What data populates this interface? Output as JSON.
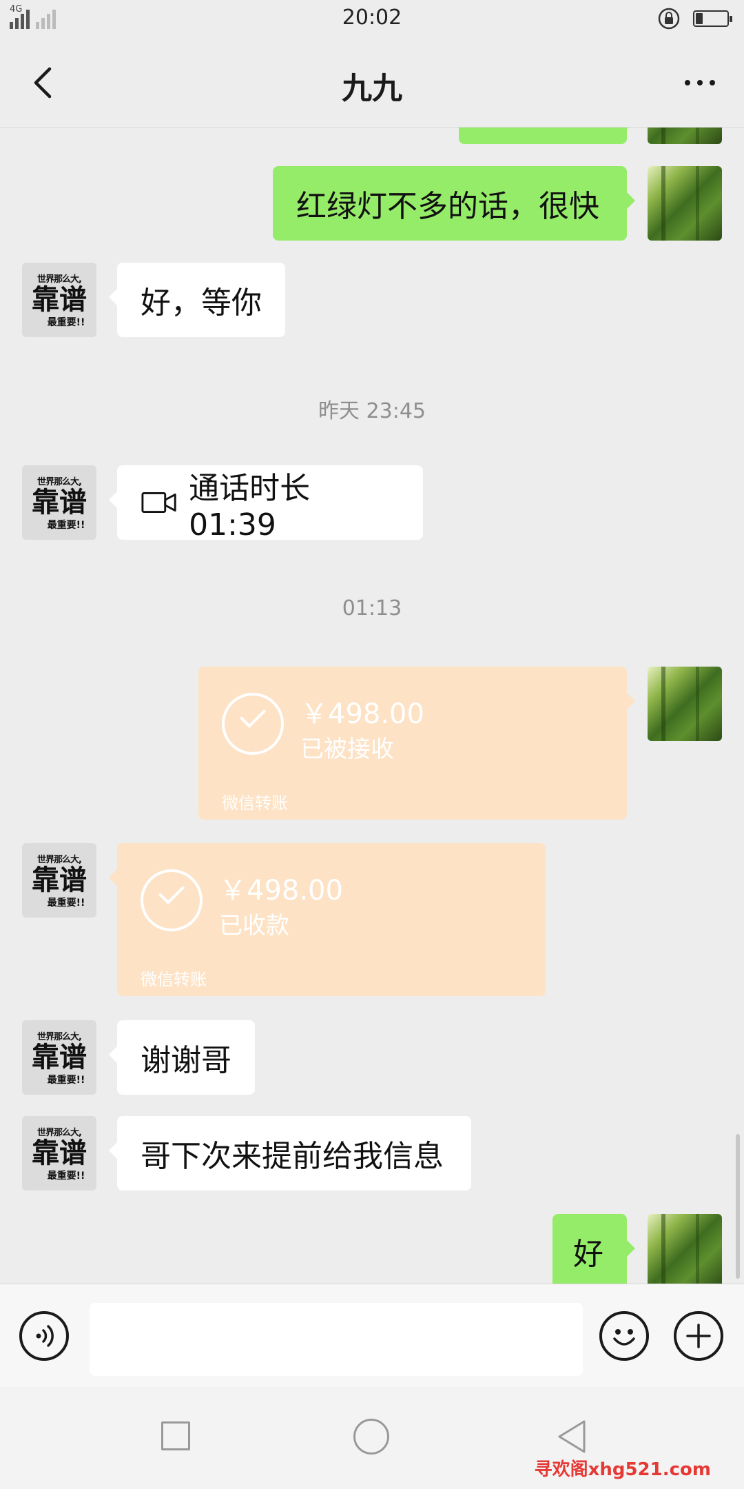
{
  "status_bar": {
    "network": "4G",
    "time": "20:02"
  },
  "header": {
    "title": "九九"
  },
  "messages": {
    "m1": "红绿灯不多的话，很快",
    "m2": "好，等你",
    "time1": "昨天 23:45",
    "call": "通话时长 01:39",
    "time2": "01:13",
    "transfer_sent": {
      "amount": "￥498.00",
      "status": "已被接收",
      "label": "微信转账"
    },
    "transfer_received": {
      "amount": "￥498.00",
      "status": "已收款",
      "label": "微信转账"
    },
    "m3": "谢谢哥",
    "m4": "哥下次来提前给我信息",
    "m5": "好"
  },
  "avatar_other": {
    "line1": "世界那么大,",
    "line2": "靠谱",
    "line3": "最重要!!"
  },
  "watermark": "寻欢阁xhg521.com",
  "colors": {
    "self_bubble": "#95ec69",
    "other_bubble": "#ffffff",
    "transfer": "#fde2c5",
    "background": "#ededed"
  },
  "icons": [
    "back-icon",
    "more-icon",
    "video-call-icon",
    "check-icon",
    "voice-icon",
    "emoji-icon",
    "plus-icon"
  ]
}
